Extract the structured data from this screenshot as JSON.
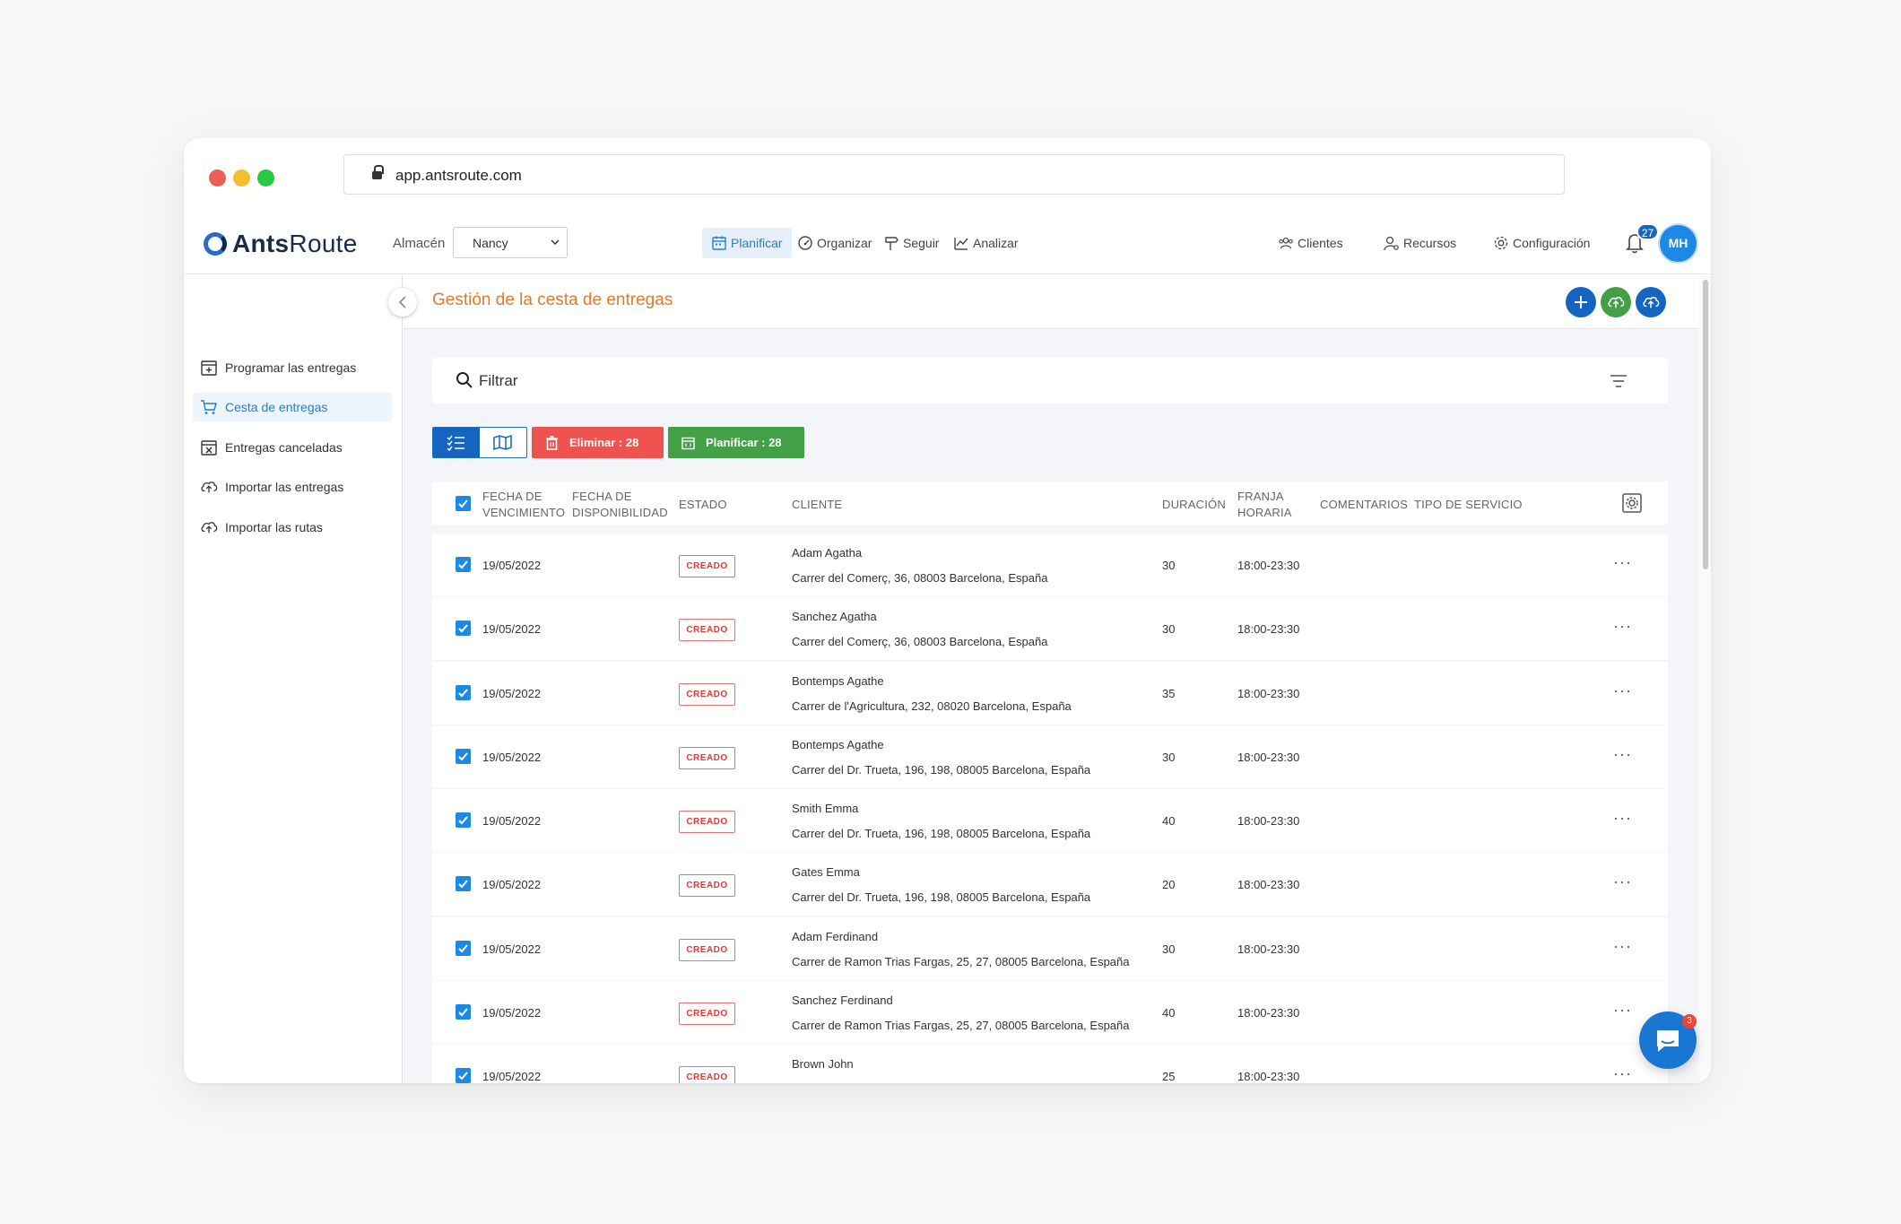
{
  "browser": {
    "url": "app.antsroute.com"
  },
  "app": {
    "logo_bold": "Ants",
    "logo_regular": "Route",
    "warehouse_label": "Almacén",
    "warehouse_value": "Nancy"
  },
  "nav": {
    "planificar": "Planificar",
    "organizar": "Organizar",
    "seguir": "Seguir",
    "analizar": "Analizar",
    "clientes": "Clientes",
    "recursos": "Recursos",
    "configuracion": "Configuración",
    "notification_count": "27",
    "avatar_initials": "MH"
  },
  "sidebar": {
    "items": [
      {
        "label": "Programar las entregas",
        "icon": "calendar-plus-icon"
      },
      {
        "label": "Cesta de entregas",
        "icon": "basket-icon",
        "active": true
      },
      {
        "label": "Entregas canceladas",
        "icon": "calendar-x-icon"
      },
      {
        "label": "Importar las entregas",
        "icon": "cloud-upload-icon"
      },
      {
        "label": "Importar las rutas",
        "icon": "cloud-upload-icon"
      }
    ]
  },
  "page": {
    "title": "Gestión de la cesta de entregas",
    "filter_label": "Filtrar",
    "delete_button": "Eliminar : 28",
    "plan_button": "Planificar : 28"
  },
  "colors": {
    "primary": "#1565c0",
    "accent_orange": "#e07a2e",
    "danger": "#ef5350",
    "success": "#43a047"
  },
  "table": {
    "headers": {
      "vencimiento_1": "FECHA DE",
      "vencimiento_2": "VENCIMIENTO",
      "disponibilidad_1": "FECHA DE",
      "disponibilidad_2": "DISPONIBILIDAD",
      "estado": "ESTADO",
      "cliente": "CLIENTE",
      "duracion": "DURACIÓN",
      "franja_1": "FRANJA",
      "franja_2": "HORARIA",
      "comentarios": "COMENTARIOS",
      "tipo_servicio": "TIPO DE SERVICIO"
    },
    "rows": [
      {
        "date": "19/05/2022",
        "status": "CREADO",
        "name": "Adam Agatha",
        "address": "Carrer del Comerç, 36, 08003 Barcelona, España",
        "duration": "30",
        "slot": "18:00-23:30"
      },
      {
        "date": "19/05/2022",
        "status": "CREADO",
        "name": "Sanchez Agatha",
        "address": "Carrer del Comerç, 36, 08003 Barcelona, España",
        "duration": "30",
        "slot": "18:00-23:30"
      },
      {
        "date": "19/05/2022",
        "status": "CREADO",
        "name": "Bontemps Agathe",
        "address": "Carrer de l'Agricultura, 232, 08020 Barcelona, España",
        "duration": "35",
        "slot": "18:00-23:30"
      },
      {
        "date": "19/05/2022",
        "status": "CREADO",
        "name": "Bontemps Agathe",
        "address": "Carrer del Dr. Trueta, 196, 198, 08005 Barcelona, España",
        "duration": "30",
        "slot": "18:00-23:30"
      },
      {
        "date": "19/05/2022",
        "status": "CREADO",
        "name": "Smith Emma",
        "address": "Carrer del Dr. Trueta, 196, 198, 08005 Barcelona, España",
        "duration": "40",
        "slot": "18:00-23:30"
      },
      {
        "date": "19/05/2022",
        "status": "CREADO",
        "name": "Gates Emma",
        "address": "Carrer del Dr. Trueta, 196, 198, 08005 Barcelona, España",
        "duration": "20",
        "slot": "18:00-23:30"
      },
      {
        "date": "19/05/2022",
        "status": "CREADO",
        "name": "Adam Ferdinand",
        "address": "Carrer de Ramon Trias Fargas, 25, 27, 08005 Barcelona, España",
        "duration": "30",
        "slot": "18:00-23:30"
      },
      {
        "date": "19/05/2022",
        "status": "CREADO",
        "name": "Sanchez Ferdinand",
        "address": "Carrer de Ramon Trias Fargas, 25, 27, 08005 Barcelona, España",
        "duration": "40",
        "slot": "18:00-23:30"
      },
      {
        "date": "19/05/2022",
        "status": "CREADO",
        "name": "Brown John",
        "address": "",
        "duration": "25",
        "slot": "18:00-23:30"
      }
    ]
  },
  "chat": {
    "unread": "3"
  }
}
